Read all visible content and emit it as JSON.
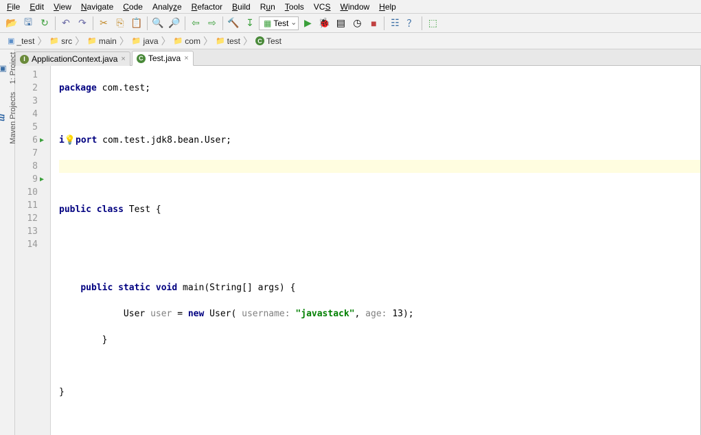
{
  "menubar": {
    "file": "File",
    "edit": "Edit",
    "view": "View",
    "navigate": "Navigate",
    "code": "Code",
    "analyze": "Analyze",
    "refactor": "Refactor",
    "build": "Build",
    "run": "Run",
    "tools": "Tools",
    "vcs": "VCS",
    "window": "Window",
    "help": "Help"
  },
  "toolbar": {
    "run_config": "Test"
  },
  "breadcrumb": {
    "items": [
      "_test",
      "src",
      "main",
      "java",
      "com",
      "test",
      "Test"
    ]
  },
  "sidebar": {
    "project": "1: Project",
    "maven": "Maven Projects",
    "maven_icon": "m"
  },
  "tabs": [
    {
      "label": "ApplicationContext.java",
      "icon": "I",
      "active": false
    },
    {
      "label": "Test.java",
      "icon": "C",
      "active": true
    }
  ],
  "code": {
    "line1": {
      "kw1": "package",
      "rest": " com.test;"
    },
    "line3": {
      "pre": "i",
      "post": "port",
      "rest": " com.test.jdk8.bean.User;"
    },
    "line6": {
      "kw1": "public ",
      "kw2": "class",
      "rest": " Test {"
    },
    "line9": {
      "kw1": "public ",
      "kw2": "static ",
      "kw3": "void",
      "rest": " main(String[] args) {"
    },
    "line10": {
      "pre": "            User ",
      "var": "user",
      "mid": " = ",
      "kw": "new",
      "mid2": " User( ",
      "p1": "username:",
      "sp1": " ",
      "str": "\"javastack\"",
      "sep": ", ",
      "p2": "age:",
      "sp2": " ",
      "num": "13",
      "end": ");"
    },
    "line11": "        }",
    "line13": "}"
  },
  "gutter": {
    "lines": [
      "1",
      "2",
      "3",
      "4",
      "5",
      "6",
      "7",
      "8",
      "9",
      "10",
      "11",
      "12",
      "13",
      "14"
    ]
  }
}
